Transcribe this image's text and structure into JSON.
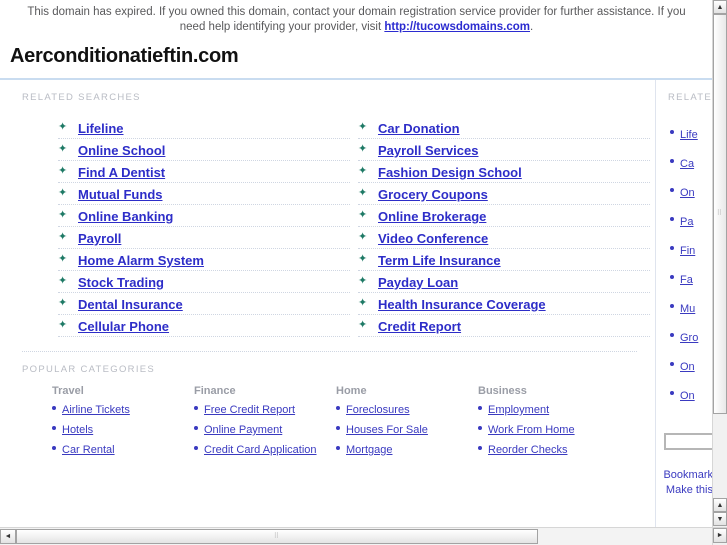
{
  "notice": {
    "text_before": "This domain has expired. If you owned this domain, contact your domain registration service provider for further assistance. If you need help identifying your provider, visit ",
    "link_label": "http://tucowsdomains.com",
    "text_after": "."
  },
  "domain": {
    "title": "Aerconditionatieftin.com"
  },
  "related": {
    "heading": "RELATED SEARCHES",
    "bullet_glyph": "✦",
    "column_left": [
      "Lifeline",
      "Online School",
      "Find A Dentist",
      "Mutual Funds",
      "Online Banking",
      "Payroll",
      "Home Alarm System",
      "Stock Trading",
      "Dental Insurance",
      "Cellular Phone"
    ],
    "column_right": [
      "Car Donation",
      "Payroll Services",
      "Fashion Design School",
      "Grocery Coupons",
      "Online Brokerage",
      "Video Conference",
      "Term Life Insurance",
      "Payday Loan",
      "Health Insurance Coverage",
      "Credit Report"
    ]
  },
  "categories": {
    "heading": "POPULAR CATEGORIES",
    "groups": [
      {
        "title": "Travel",
        "items": [
          "Airline Tickets",
          "Hotels",
          "Car Rental"
        ]
      },
      {
        "title": "Finance",
        "items": [
          "Free Credit Report",
          "Online Payment",
          "Credit Card Application"
        ]
      },
      {
        "title": "Home",
        "items": [
          "Foreclosures",
          "Houses For Sale",
          "Mortgage"
        ]
      },
      {
        "title": "Business",
        "items": [
          "Employment",
          "Work From Home",
          "Reorder Checks"
        ]
      }
    ]
  },
  "sidebar": {
    "heading": "RELATED",
    "items": [
      "Life",
      "Ca",
      "On",
      "Pa",
      "Fin",
      "Fa",
      "Mu",
      "Gro",
      "On",
      "On"
    ],
    "search_value": "",
    "search_placeholder": "",
    "bookmark_label": "Bookmark",
    "makehome_label": "Make this"
  },
  "scrollbars": {
    "up_glyph": "▲",
    "down_glyph": "▼",
    "left_glyph": "◄",
    "right_glyph": "►",
    "grip_glyph": "⠿"
  },
  "colors": {
    "link": "#2d2dc8",
    "bullet_teal": "#1f7a66",
    "heading_gray": "#b9bcc4",
    "title_rule": "#c9dcf0"
  }
}
